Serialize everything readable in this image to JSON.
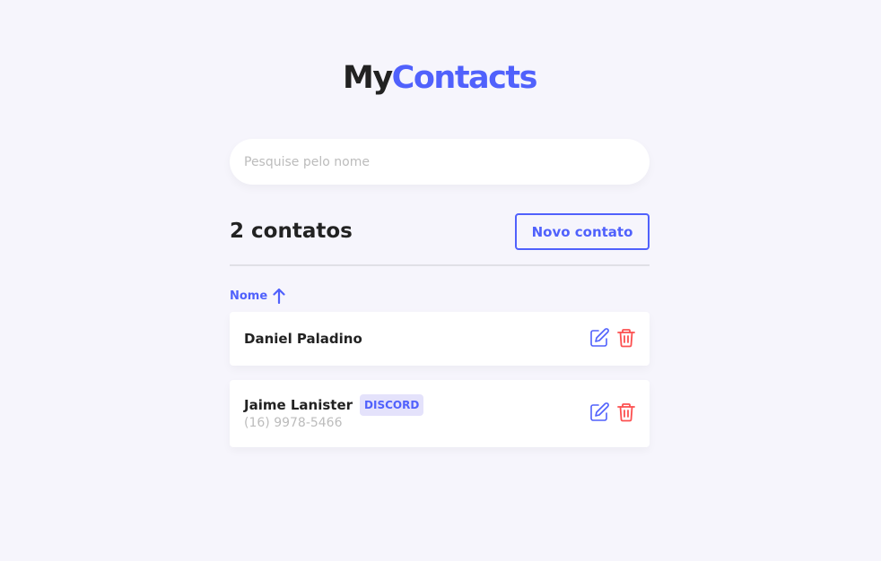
{
  "brand": {
    "part1": "My",
    "part2": "Contacts"
  },
  "search": {
    "placeholder": "Pesquise pelo nome",
    "value": ""
  },
  "header": {
    "count_label": "2 contatos",
    "new_button_label": "Novo contato"
  },
  "sort": {
    "label": "Nome",
    "direction": "asc",
    "icon": "arrow-up-icon"
  },
  "contacts": [
    {
      "name": "Daniel Paladino",
      "category": "",
      "phone": ""
    },
    {
      "name": "Jaime Lanister",
      "category": "DISCORD",
      "phone": "(16) 9978-5466"
    }
  ],
  "icons": {
    "edit": "edit-icon",
    "delete": "trash-icon"
  },
  "colors": {
    "primary": "#5061FC",
    "danger": "#FC5050",
    "text": "#222222",
    "muted": "#BCBCBC",
    "background": "#F6F5FC",
    "badge_bg": "#E4E2FB"
  }
}
